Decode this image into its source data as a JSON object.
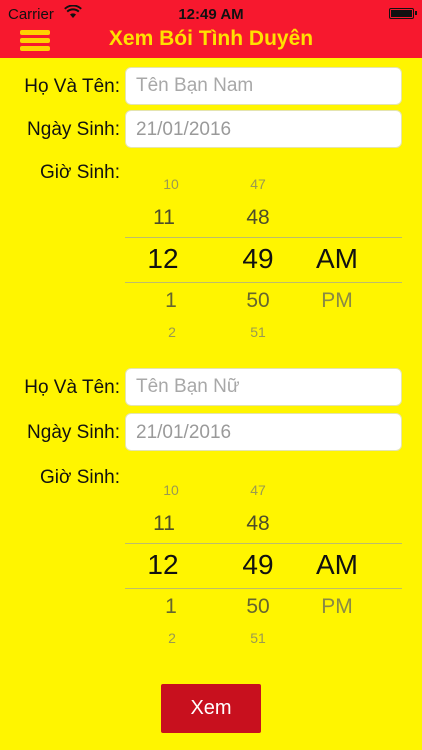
{
  "status_bar": {
    "carrier": "Carrier",
    "time": "12:49 AM",
    "wifi_icon": "wifi-icon",
    "battery_icon": "battery-icon"
  },
  "nav": {
    "title": "Xem Bói Tình Duyên",
    "menu_icon": "hamburger-menu-icon",
    "title_color": "#FFE100",
    "bar_color": "#F7182E"
  },
  "person1": {
    "name_label": "Họ Và Tên:",
    "name_placeholder": "Tên Bạn Nam",
    "birthdate_label": "Ngày Sinh:",
    "birthdate_value": "21/01/2016",
    "birthtime_label": "Giờ Sinh:",
    "picker": {
      "hours": [
        "10",
        "11",
        "12",
        "1",
        "2"
      ],
      "minutes": [
        "47",
        "48",
        "49",
        "50",
        "51"
      ],
      "ampm": [
        "AM",
        "PM"
      ]
    }
  },
  "person2": {
    "name_label": "Họ Và Tên:",
    "name_placeholder": "Tên Bạn Nữ",
    "birthdate_label": "Ngày Sinh:",
    "birthdate_value": "21/01/2016",
    "birthtime_label": "Giờ Sinh:",
    "picker": {
      "hours": [
        "10",
        "11",
        "12",
        "1",
        "2"
      ],
      "minutes": [
        "47",
        "48",
        "49",
        "50",
        "51"
      ],
      "ampm": [
        "AM",
        "PM"
      ]
    }
  },
  "submit_label": "Xem",
  "colors": {
    "background": "#FFF500",
    "submit": "#C8101E"
  }
}
